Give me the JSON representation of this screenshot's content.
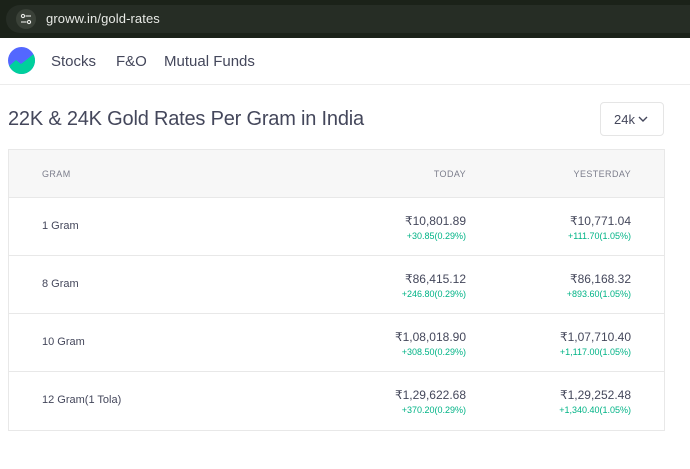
{
  "browser": {
    "url": "groww.in/gold-rates"
  },
  "nav": {
    "items": [
      "Stocks",
      "F&O",
      "Mutual Funds"
    ]
  },
  "page": {
    "title": "22K & 24K Gold Rates Per Gram in India",
    "karat_select": "24k"
  },
  "table": {
    "headers": [
      "GRAM",
      "TODAY",
      "YESTERDAY"
    ],
    "rows": [
      {
        "gram": "1 Gram",
        "today": "₹10,801.89",
        "today_change": "+30.85(0.29%)",
        "yesterday": "₹10,771.04",
        "yesterday_change": "+111.70(1.05%)"
      },
      {
        "gram": "8 Gram",
        "today": "₹86,415.12",
        "today_change": "+246.80(0.29%)",
        "yesterday": "₹86,168.32",
        "yesterday_change": "+893.60(1.05%)"
      },
      {
        "gram": "10 Gram",
        "today": "₹1,08,018.90",
        "today_change": "+308.50(0.29%)",
        "yesterday": "₹1,07,710.40",
        "yesterday_change": "+1,117.00(1.05%)"
      },
      {
        "gram": "12 Gram(1 Tola)",
        "today": "₹1,29,622.68",
        "today_change": "+370.20(0.29%)",
        "yesterday": "₹1,29,252.48",
        "yesterday_change": "+1,340.40(1.05%)"
      }
    ]
  },
  "colors": {
    "positive": "#00b386",
    "text": "#44475b",
    "header_bg": "#f7f7f7"
  },
  "icons": {
    "site": "site-settings-icon",
    "logo": "groww-logo",
    "dropdown": "chevron-down-icon"
  }
}
